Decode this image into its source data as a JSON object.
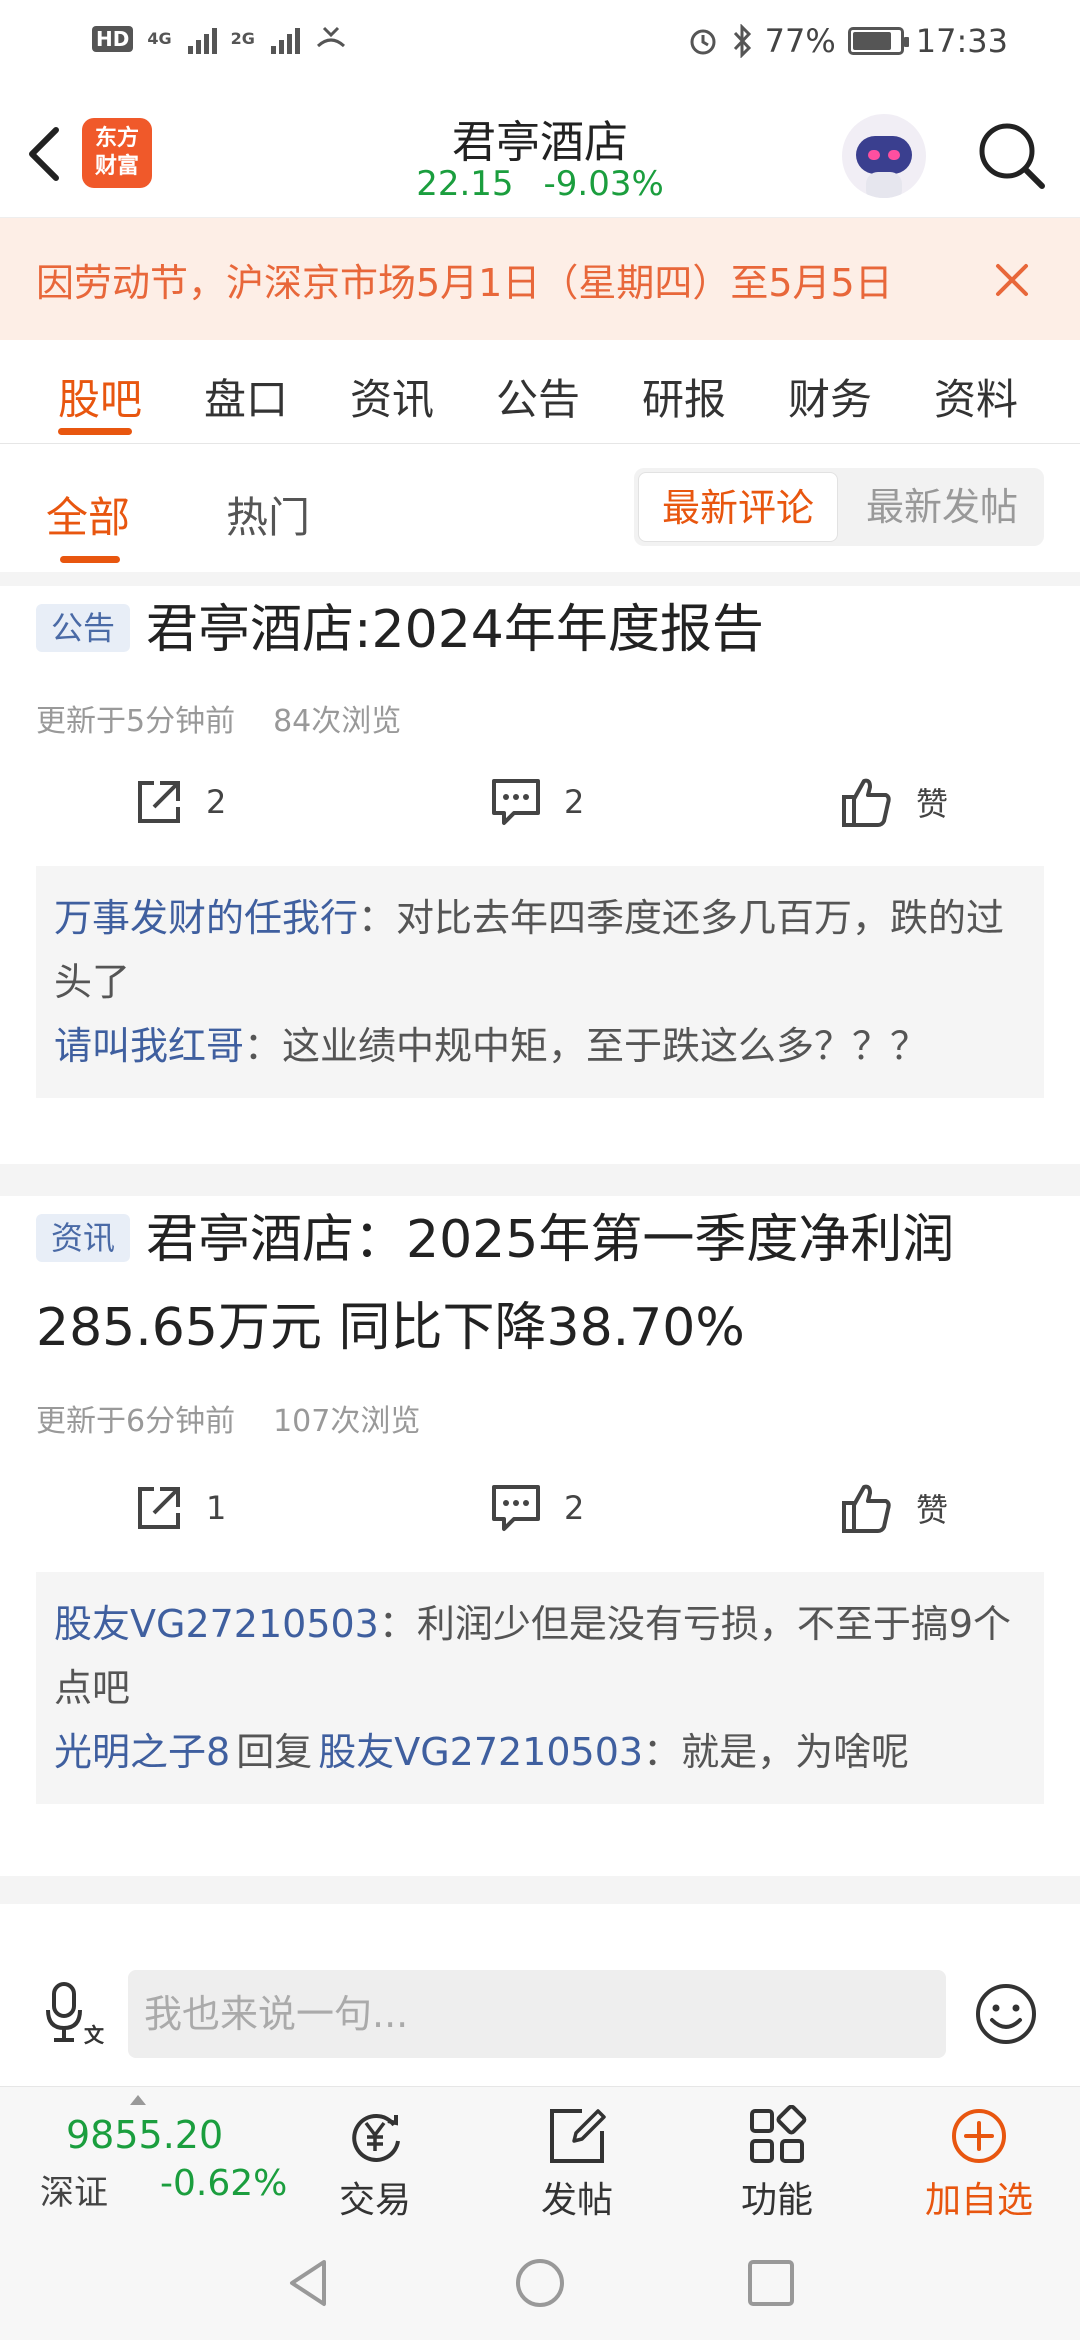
{
  "status_bar": {
    "hd_label": "HD",
    "sim1_label": "4G",
    "sim2_label": "2G",
    "battery_percent": "77%",
    "time": "17:33",
    "icons": [
      "alarm-icon",
      "bluetooth-icon",
      "battery-icon"
    ]
  },
  "header": {
    "logo_text": "东方\n财富",
    "title": "君亭酒店",
    "price": "22.15",
    "change_percent": "-9.03%",
    "quote_color": "#1b9e3e"
  },
  "notice": {
    "text": "因劳动节，沪深京市场5月1日（星期四）至5月5日",
    "color": "#e8673a"
  },
  "tabs": [
    "股吧",
    "盘口",
    "资讯",
    "公告",
    "研报",
    "财务",
    "资料"
  ],
  "subtabs": {
    "all": "全部",
    "hot": "热门",
    "sort_latest_comment": "最新评论",
    "sort_latest_post": "最新发帖"
  },
  "posts": [
    {
      "tag": "公告",
      "title": "君亭酒店:2024年年度报告",
      "updated": "更新于5分钟前",
      "views": "84次浏览",
      "shares": "2",
      "comment_count": "2",
      "like_label": "赞",
      "comments": [
        {
          "user": "万事发财的任我行",
          "text": "：对比去年四季度还多几百万，跌的过头了"
        },
        {
          "user": "请叫我红哥",
          "text": "：这业绩中规中矩，至于跌这么多？？？"
        }
      ]
    },
    {
      "tag": "资讯",
      "title": "君亭酒店：2025年第一季度净利润285.65万元 同比下降38.70%",
      "updated": "更新于6分钟前",
      "views": "107次浏览",
      "shares": "1",
      "comment_count": "2",
      "like_label": "赞",
      "comments": [
        {
          "user": "股友VG27210503",
          "text": "：利润少但是没有亏损，不至于搞9个点吧"
        },
        {
          "user": "光明之子8",
          "reply_word": "回复",
          "reply_to": "股友VG27210503",
          "text": "：就是，为啥呢"
        }
      ]
    }
  ],
  "input_bar": {
    "placeholder": "我也来说一句..."
  },
  "bottom_nav": {
    "index_value": "9855.20",
    "index_name": "深证",
    "index_change": "-0.62%",
    "items": [
      "交易",
      "发帖",
      "功能",
      "加自选"
    ],
    "accent_color": "#e8560f"
  }
}
